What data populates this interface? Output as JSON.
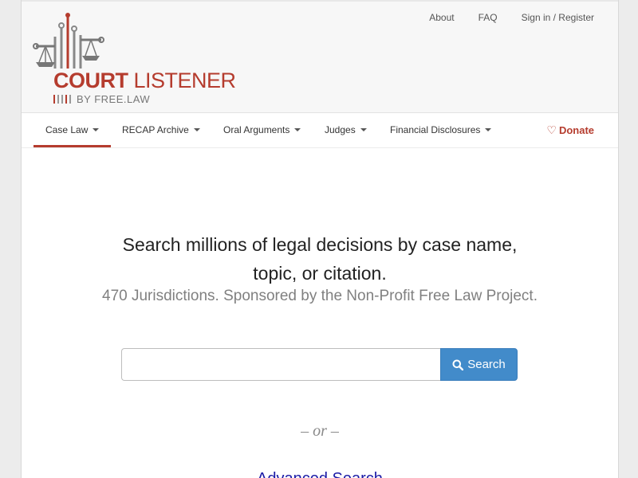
{
  "brand": {
    "name_bold": "COURT",
    "name_light": "LISTENER",
    "tagline": "BY FREE.LAW",
    "accent_color": "#b53c2e"
  },
  "top_links": {
    "about": "About",
    "faq": "FAQ",
    "signin": "Sign in / Register"
  },
  "nav": {
    "items": [
      {
        "label": "Case Law",
        "active": true
      },
      {
        "label": "RECAP Archive"
      },
      {
        "label": "Oral Arguments"
      },
      {
        "label": "Judges"
      },
      {
        "label": "Financial Disclosures"
      }
    ],
    "donate_label": "Donate",
    "donate_icon": "heart-icon"
  },
  "hero": {
    "title_line1": "Search millions of legal decisions by case name,",
    "title_line2": "topic, or citation.",
    "subtitle": "470 Jurisdictions. Sponsored by the Non-Profit Free Law Project."
  },
  "search": {
    "value": "",
    "placeholder": "",
    "button_label": "Search",
    "button_icon": "search-icon",
    "button_color": "#428bca"
  },
  "or_text": "– or –",
  "advanced_link": "Advanced Search"
}
